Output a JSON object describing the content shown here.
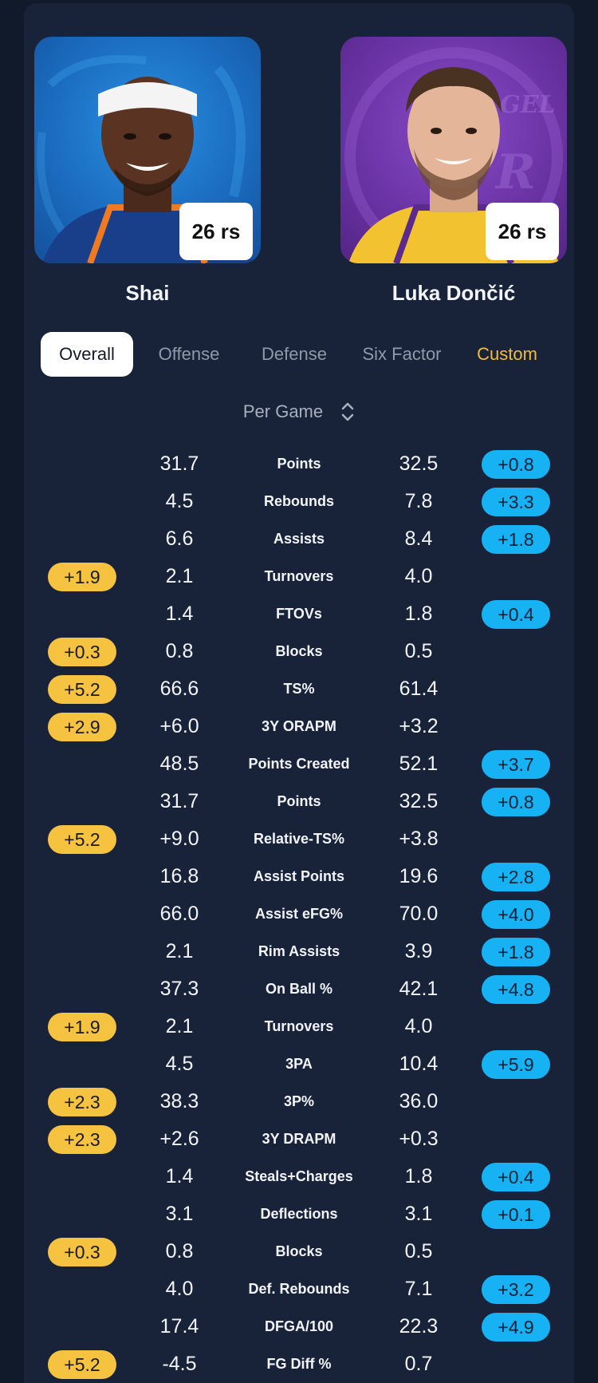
{
  "players": {
    "left": {
      "name": "Shai",
      "age": "26 rs",
      "team_color": "#1b6cc0"
    },
    "right": {
      "name": "Luka Dončić",
      "age": "26 rs",
      "team_color": "#6b34a6"
    }
  },
  "tabs": [
    "Overall",
    "Offense",
    "Defense",
    "Six Factor",
    "Custom"
  ],
  "active_tab": "Overall",
  "mode": {
    "label": "Per Game",
    "icon": "sort-updown-icon"
  },
  "colors": {
    "left_advantage": "#f6c340",
    "right_advantage": "#16b2f3",
    "custom_tab": "#f3bb3a"
  },
  "rows": [
    {
      "metric": "Points",
      "left": "31.7",
      "right": "32.5",
      "left_badge": "",
      "right_badge": "+0.8"
    },
    {
      "metric": "Rebounds",
      "left": "4.5",
      "right": "7.8",
      "left_badge": "",
      "right_badge": "+3.3"
    },
    {
      "metric": "Assists",
      "left": "6.6",
      "right": "8.4",
      "left_badge": "",
      "right_badge": "+1.8"
    },
    {
      "metric": "Turnovers",
      "left": "2.1",
      "right": "4.0",
      "left_badge": "+1.9",
      "right_badge": ""
    },
    {
      "metric": "FTOVs",
      "left": "1.4",
      "right": "1.8",
      "left_badge": "",
      "right_badge": "+0.4"
    },
    {
      "metric": "Blocks",
      "left": "0.8",
      "right": "0.5",
      "left_badge": "+0.3",
      "right_badge": ""
    },
    {
      "metric": "TS%",
      "left": "66.6",
      "right": "61.4",
      "left_badge": "+5.2",
      "right_badge": ""
    },
    {
      "metric": "3Y ORAPM",
      "left": "+6.0",
      "right": "+3.2",
      "left_badge": "+2.9",
      "right_badge": ""
    },
    {
      "metric": "Points Created",
      "left": "48.5",
      "right": "52.1",
      "left_badge": "",
      "right_badge": "+3.7"
    },
    {
      "metric": "Points",
      "left": "31.7",
      "right": "32.5",
      "left_badge": "",
      "right_badge": "+0.8"
    },
    {
      "metric": "Relative-TS%",
      "left": "+9.0",
      "right": "+3.8",
      "left_badge": "+5.2",
      "right_badge": ""
    },
    {
      "metric": "Assist Points",
      "left": "16.8",
      "right": "19.6",
      "left_badge": "",
      "right_badge": "+2.8"
    },
    {
      "metric": "Assist eFG%",
      "left": "66.0",
      "right": "70.0",
      "left_badge": "",
      "right_badge": "+4.0"
    },
    {
      "metric": "Rim Assists",
      "left": "2.1",
      "right": "3.9",
      "left_badge": "",
      "right_badge": "+1.8"
    },
    {
      "metric": "On Ball %",
      "left": "37.3",
      "right": "42.1",
      "left_badge": "",
      "right_badge": "+4.8"
    },
    {
      "metric": "Turnovers",
      "left": "2.1",
      "right": "4.0",
      "left_badge": "+1.9",
      "right_badge": ""
    },
    {
      "metric": "3PA",
      "left": "4.5",
      "right": "10.4",
      "left_badge": "",
      "right_badge": "+5.9"
    },
    {
      "metric": "3P%",
      "left": "38.3",
      "right": "36.0",
      "left_badge": "+2.3",
      "right_badge": ""
    },
    {
      "metric": "3Y DRAPM",
      "left": "+2.6",
      "right": "+0.3",
      "left_badge": "+2.3",
      "right_badge": ""
    },
    {
      "metric": "Steals+Charges",
      "left": "1.4",
      "right": "1.8",
      "left_badge": "",
      "right_badge": "+0.4"
    },
    {
      "metric": "Deflections",
      "left": "3.1",
      "right": "3.1",
      "left_badge": "",
      "right_badge": "+0.1"
    },
    {
      "metric": "Blocks",
      "left": "0.8",
      "right": "0.5",
      "left_badge": "+0.3",
      "right_badge": ""
    },
    {
      "metric": "Def. Rebounds",
      "left": "4.0",
      "right": "7.1",
      "left_badge": "",
      "right_badge": "+3.2"
    },
    {
      "metric": "DFGA/100",
      "left": "17.4",
      "right": "22.3",
      "left_badge": "",
      "right_badge": "+4.9"
    },
    {
      "metric": "FG Diff %",
      "left": "-4.5",
      "right": "0.7",
      "left_badge": "+5.2",
      "right_badge": ""
    }
  ]
}
